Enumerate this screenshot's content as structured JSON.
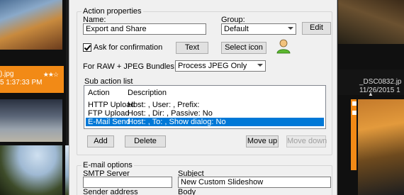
{
  "background": {
    "left_caption_filename": ").jpg",
    "left_caption_stars": "★★☆",
    "left_caption_date": "5 1:37:33 PM",
    "right_caption_filename": "_DSC0832.jp",
    "right_caption_date": "11/26/2015 1"
  },
  "action_properties": {
    "group_title": "Action properties",
    "name_label": "Name:",
    "name_value": "Export and Share",
    "group_label": "Group:",
    "group_value": "Default",
    "edit_button": "Edit",
    "ask_confirmation_label": "Ask for confirmation",
    "ask_confirmation_checked": true,
    "text_button": "Text",
    "select_icon_button": "Select icon",
    "action_icon": "user-icon",
    "raw_jpeg_label": "For RAW + JPEG Bundles:",
    "raw_jpeg_value": "Process JPEG Only"
  },
  "sub_action_list": {
    "title": "Sub action list",
    "columns": [
      "Action",
      "Description"
    ],
    "rows": [
      {
        "action": "HTTP Upload",
        "description": "Host: , User: , Prefix:",
        "selected": false
      },
      {
        "action": "FTP Upload",
        "description": "Host: , Dir: , Passive: No",
        "selected": false
      },
      {
        "action": "E-Mail Send",
        "description": "Host: , To: , Show dialog: No",
        "selected": true
      }
    ],
    "add_button": "Add",
    "delete_button": "Delete",
    "move_up_button": "Move up",
    "move_down_button": "Move down"
  },
  "email_options": {
    "title": "E-mail options",
    "smtp_label": "SMTP Server",
    "smtp_value": "",
    "subject_label": "Subject",
    "subject_value": "New Custom Slideshow",
    "sender_label": "Sender address",
    "body_label": "Body"
  },
  "colors": {
    "selection": "#0078d7",
    "accent_orange": "#f28a16",
    "dialog_bg": "#f0f0f0"
  }
}
